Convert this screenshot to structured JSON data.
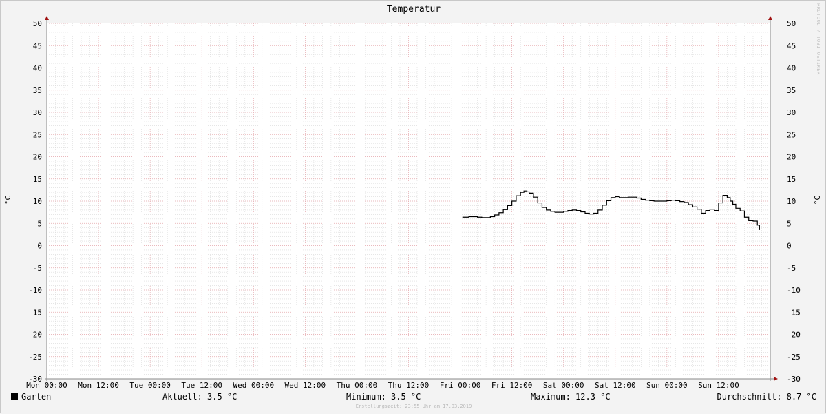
{
  "chart_data": {
    "type": "line",
    "title": "Temperatur",
    "ylabel": "°C",
    "ylim": [
      -30,
      50
    ],
    "yticks": [
      50,
      45,
      40,
      35,
      30,
      25,
      20,
      15,
      10,
      5,
      0,
      -5,
      -10,
      -15,
      -20,
      -25,
      -30
    ],
    "xticks": [
      "Mon 00:00",
      "Mon 12:00",
      "Tue 00:00",
      "Tue 12:00",
      "Wed 00:00",
      "Wed 12:00",
      "Thu 00:00",
      "Thu 12:00",
      "Fri 00:00",
      "Fri 12:00",
      "Sat 00:00",
      "Sat 12:00",
      "Sun 00:00",
      "Sun 12:00"
    ],
    "x_unit": "hours since Mon 00:00",
    "xlim": [
      0,
      168
    ],
    "grid": true,
    "series": [
      {
        "name": "Garten",
        "color": "#000000",
        "x": [
          96.5,
          98,
          99,
          100,
          101,
          102,
          103,
          104,
          105,
          106,
          107,
          108,
          109,
          110,
          110.8,
          111.5,
          112,
          113,
          114,
          115,
          116,
          117,
          118,
          119,
          120,
          121,
          122,
          123,
          124,
          125,
          126,
          127,
          128,
          129,
          130,
          131,
          132,
          133,
          134,
          135,
          136,
          137,
          138,
          139,
          140,
          141,
          142,
          143,
          144,
          145,
          146,
          147,
          148,
          149,
          150,
          151,
          152,
          153,
          154,
          155,
          156,
          157,
          158,
          158.7,
          159.3,
          160,
          161,
          162,
          163,
          164,
          165,
          165.5
        ],
        "values": [
          6.4,
          6.5,
          6.5,
          6.4,
          6.3,
          6.3,
          6.5,
          6.9,
          7.4,
          8.1,
          9.0,
          10.0,
          11.2,
          12.0,
          12.3,
          12.1,
          11.8,
          10.9,
          9.6,
          8.6,
          8.0,
          7.7,
          7.5,
          7.5,
          7.7,
          7.9,
          8.0,
          7.9,
          7.6,
          7.3,
          7.1,
          7.3,
          8.0,
          9.1,
          10.1,
          10.8,
          11.0,
          10.8,
          10.8,
          10.9,
          10.9,
          10.7,
          10.4,
          10.2,
          10.1,
          10.0,
          10.0,
          10.0,
          10.1,
          10.2,
          10.1,
          9.9,
          9.7,
          9.2,
          8.7,
          8.2,
          7.3,
          7.9,
          8.2,
          7.9,
          9.6,
          11.3,
          10.8,
          10.0,
          9.3,
          8.4,
          7.8,
          6.4,
          5.6,
          5.5,
          4.6,
          3.5
        ]
      }
    ]
  },
  "legend": {
    "series_name": "Garten",
    "aktuell": "Aktuell: 3.5 °C",
    "minimum": "Minimum: 3.5 °C",
    "maximum": "Maximum: 12.3 °C",
    "durchschnitt": "Durchschnitt: 8.7 °C"
  },
  "watermark": "RRDTOOL / TOBI OETIKER",
  "footer": "Erstellungszeit: 23:55 Uhr am 17.03.2019",
  "colors": {
    "background": "#f3f3f3",
    "plot_background": "#ffffff",
    "major_grid": "#e3a3a8",
    "minor_grid": "#d8d8d8",
    "axis": "#8a8a8a",
    "arrow": "#a01010",
    "line": "#000000"
  }
}
